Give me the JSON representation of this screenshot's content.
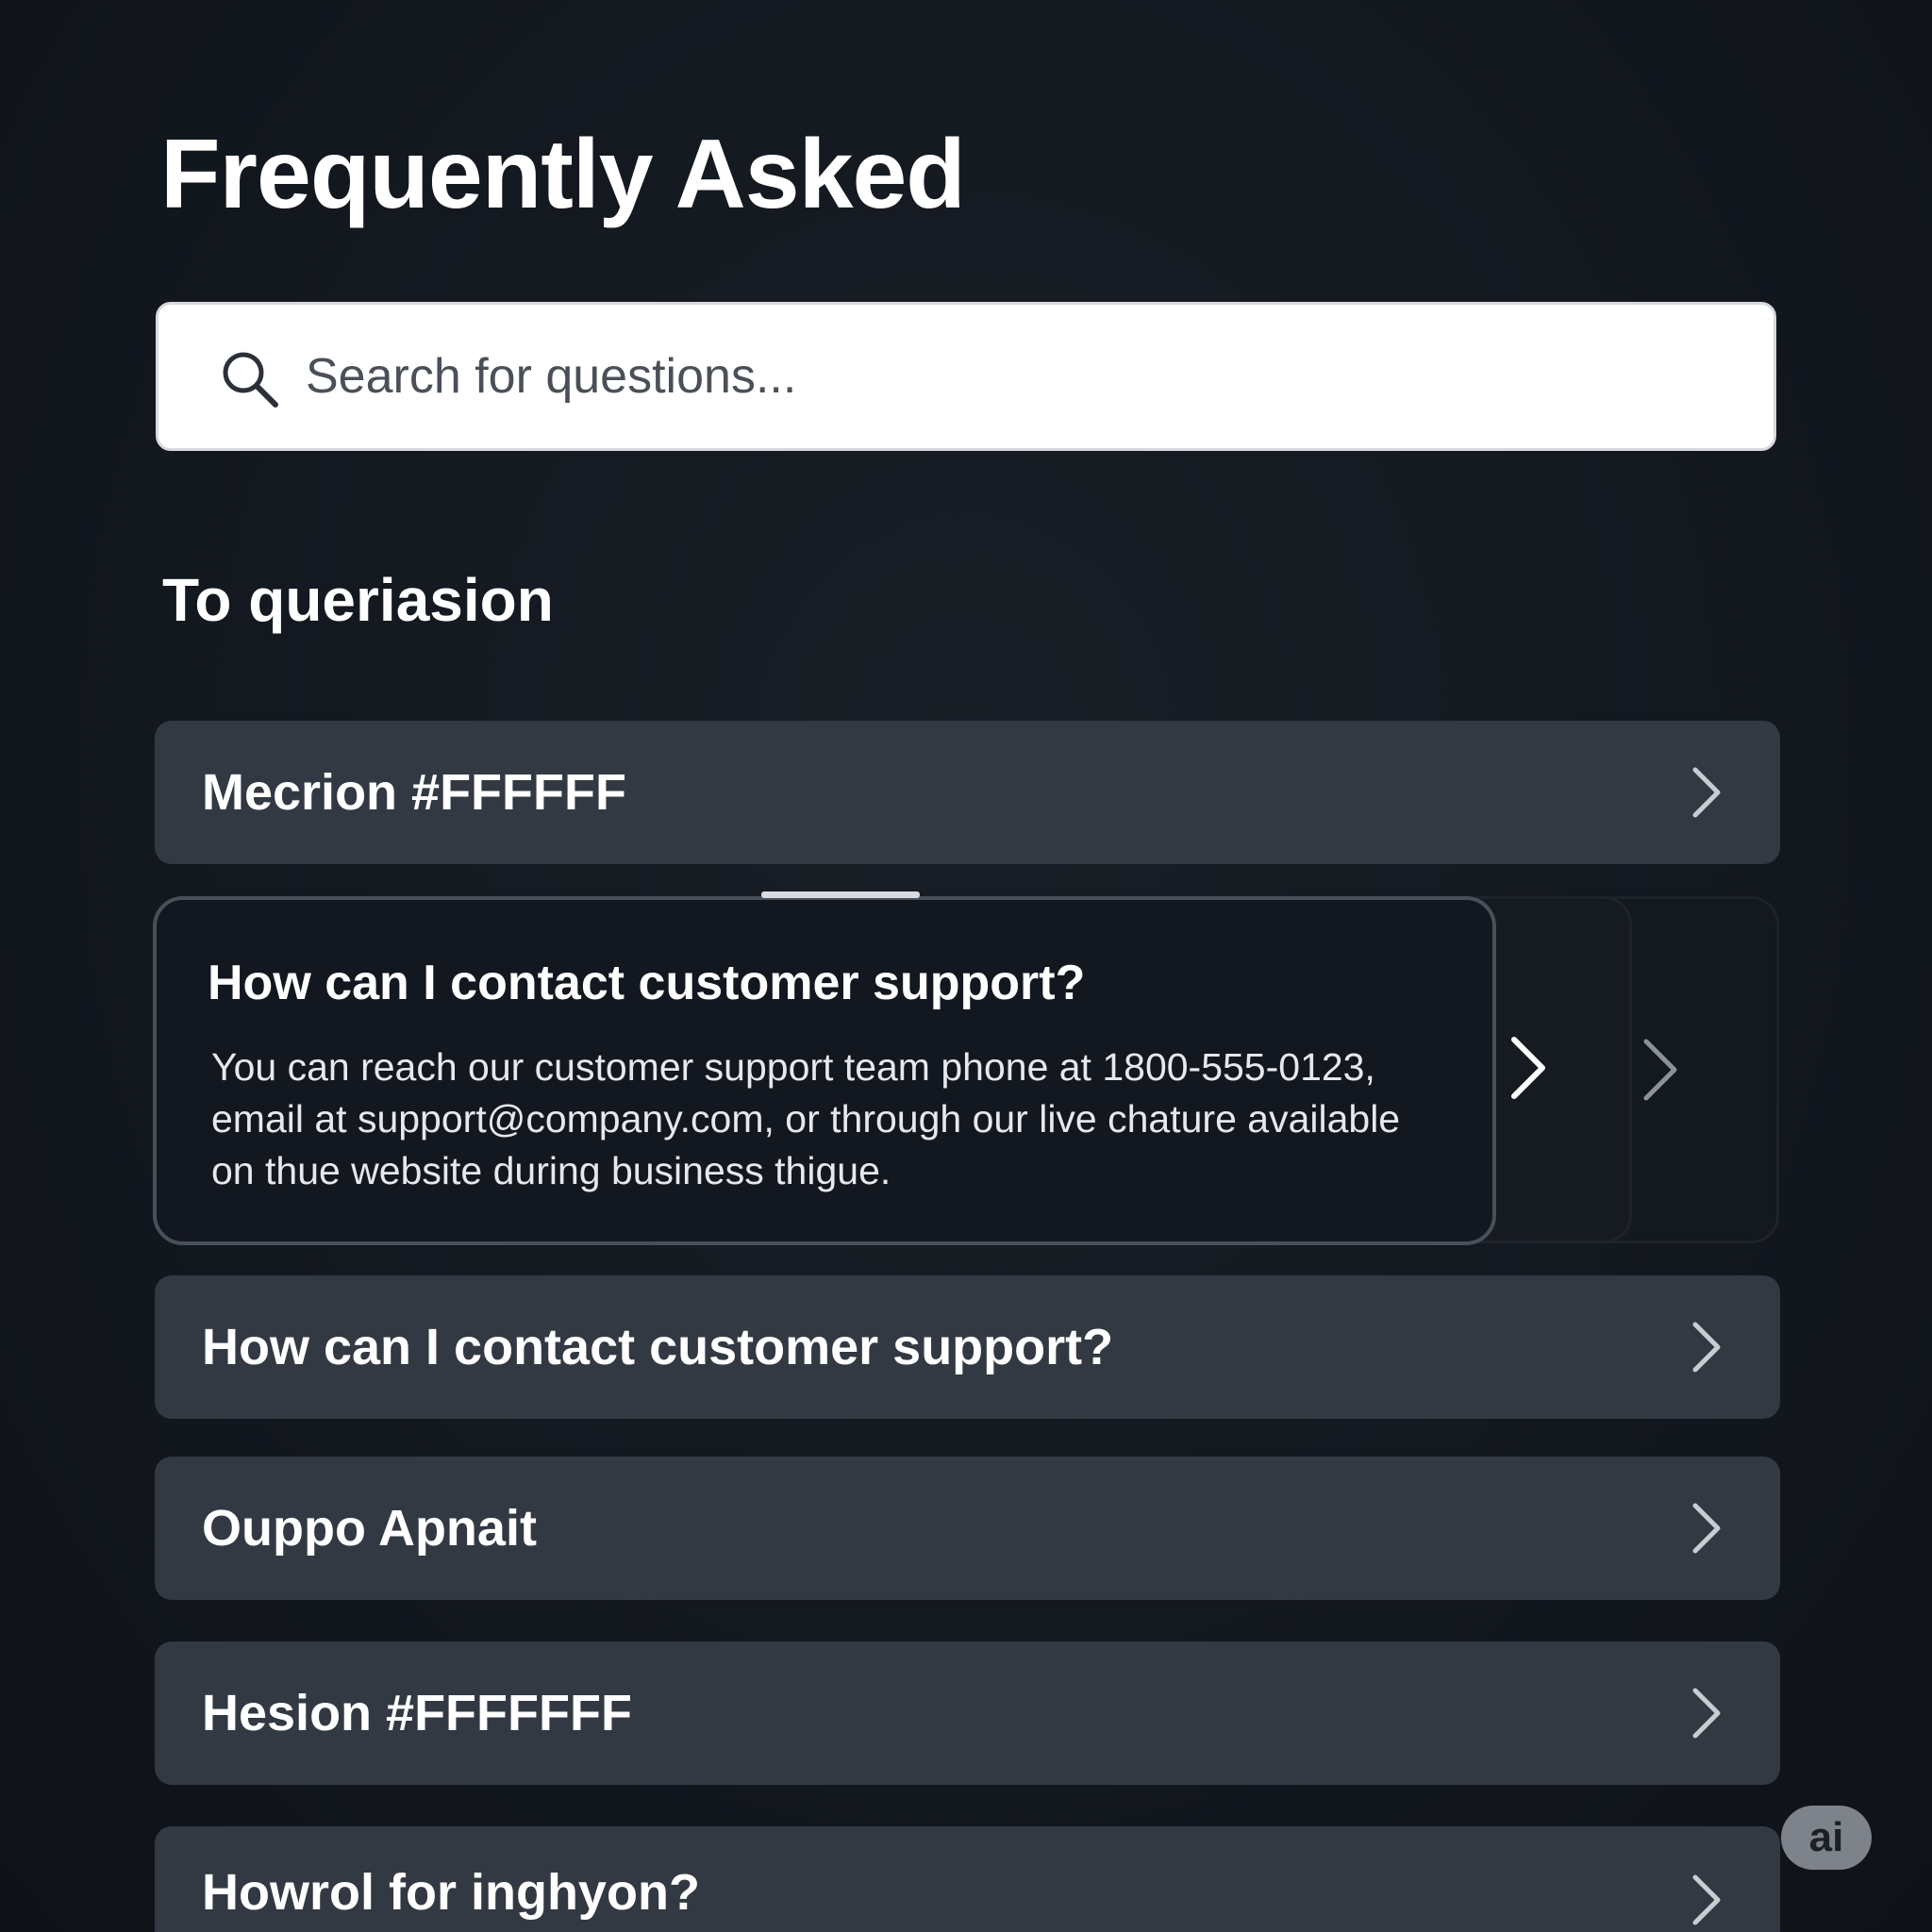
{
  "header": {
    "title": "Frequently Asked"
  },
  "search": {
    "placeholder": "Search for questions..."
  },
  "section": {
    "title": "To queriasion"
  },
  "faq": {
    "items": [
      {
        "label": "Mecrion #FFFFFF"
      },
      {
        "question": "How can I contact customer support?",
        "answer": "You can reach our customer support team phone at 1800-555-0123, email at support@company.com, or through our live chature available on thue website during business thigue.",
        "expanded": true
      },
      {
        "label": "How can I contact customer support?"
      },
      {
        "label": "Ouppo Apnait"
      },
      {
        "label": "Hesion #FFFFFFF"
      },
      {
        "label": "Howrol for inghyon?"
      }
    ]
  },
  "badge": {
    "label": "ai"
  },
  "icons": {
    "search": "search-icon",
    "chevron": "chevron-right-icon"
  },
  "colors": {
    "background": "#12161d",
    "item_background": "#333943",
    "search_background": "#ffffff",
    "expanded_background": "#131720"
  }
}
